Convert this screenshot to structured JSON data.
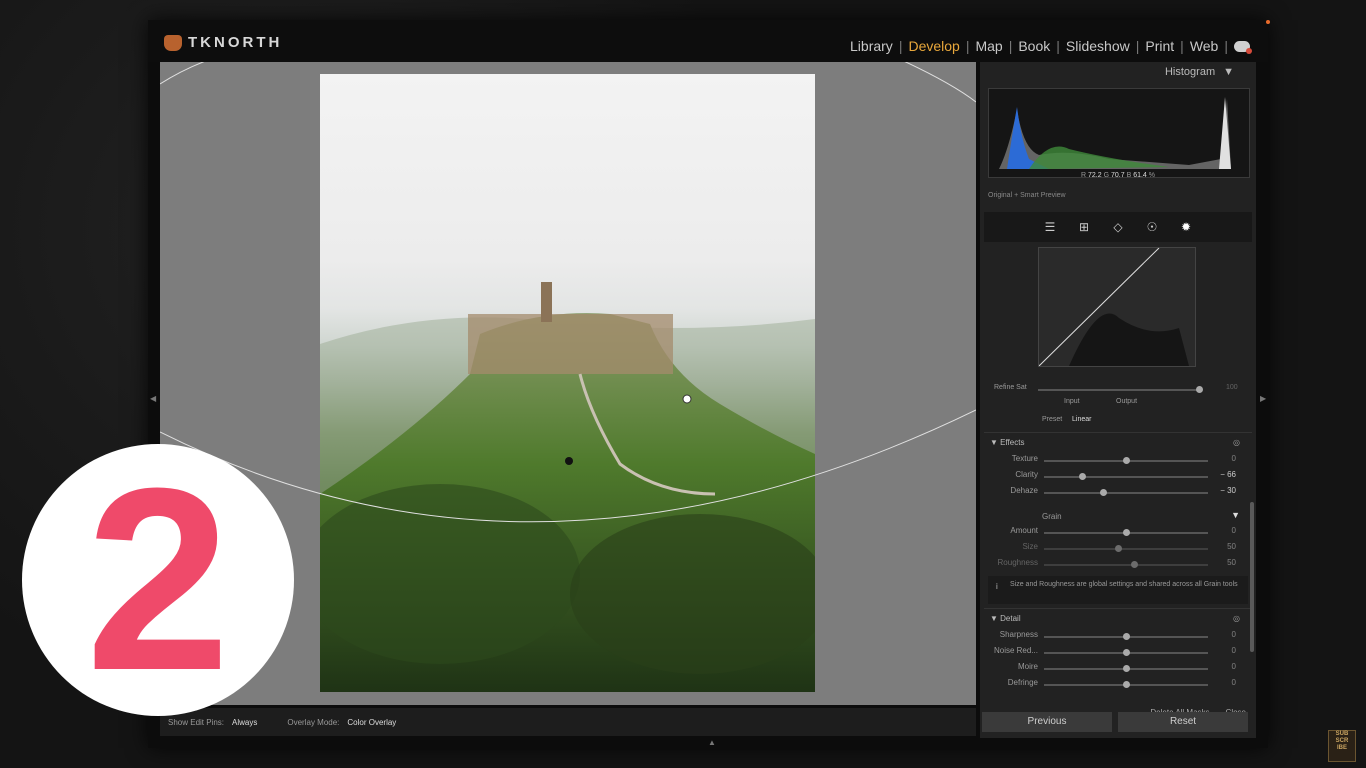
{
  "brand": {
    "name": "TKNORTH"
  },
  "modules": {
    "library": "Library",
    "develop": "Develop",
    "map": "Map",
    "book": "Book",
    "slideshow": "Slideshow",
    "print": "Print",
    "web": "Web",
    "sep": "|"
  },
  "histogram": {
    "title": "Histogram",
    "r_label": "R",
    "r_value": "72.2",
    "g_label": "G",
    "g_value": "70.7",
    "b_label": "B",
    "b_value": "61.4",
    "percent": "%",
    "preview": "Original + Smart Preview"
  },
  "curve": {
    "refine_label": "Refine Sat",
    "refine_value": "100",
    "input_label": "Input",
    "output_label": "Output",
    "preset_label": "Preset",
    "preset_value": "Linear"
  },
  "effects": {
    "title": "Effects",
    "texture_label": "Texture",
    "texture_value": "0",
    "texture_pos": 0.5,
    "clarity_label": "Clarity",
    "clarity_value": "− 66",
    "clarity_pos": 0.23,
    "dehaze_label": "Dehaze",
    "dehaze_value": "− 30",
    "dehaze_pos": 0.36,
    "grain_title": "Grain",
    "amount_label": "Amount",
    "amount_value": "0",
    "amount_pos": 0.5,
    "size_label": "Size",
    "size_value": "50",
    "size_pos": 0.45,
    "roughness_label": "Roughness",
    "roughness_value": "50",
    "roughness_pos": 0.55,
    "info": "Size and Roughness are global settings and shared across all Grain tools"
  },
  "detail": {
    "title": "Detail",
    "sharpness_label": "Sharpness",
    "sharpness_value": "0",
    "sharpness_pos": 0.5,
    "noise_label": "Noise Red...",
    "noise_value": "0",
    "noise_pos": 0.5,
    "moire_label": "Moire",
    "moire_value": "0",
    "moire_pos": 0.5,
    "defringe_label": "Defringe",
    "defringe_value": "0",
    "defringe_pos": 0.5
  },
  "mask_actions": {
    "delete_all": "Delete All Masks",
    "close": "Close"
  },
  "buttons": {
    "previous": "Previous",
    "reset": "Reset"
  },
  "toolbar": {
    "show_pins_label": "Show Edit Pins:",
    "show_pins_value": "Always",
    "overlay_label": "Overlay Mode:",
    "overlay_value": "Color Overlay"
  },
  "overlay": {
    "number": "2"
  },
  "subscribe": {
    "l1": "SUB",
    "l2": "SCR",
    "l3": "IBE"
  },
  "colors": {
    "accent": "#e8a73b",
    "badge_number": "#ef4a6a"
  }
}
